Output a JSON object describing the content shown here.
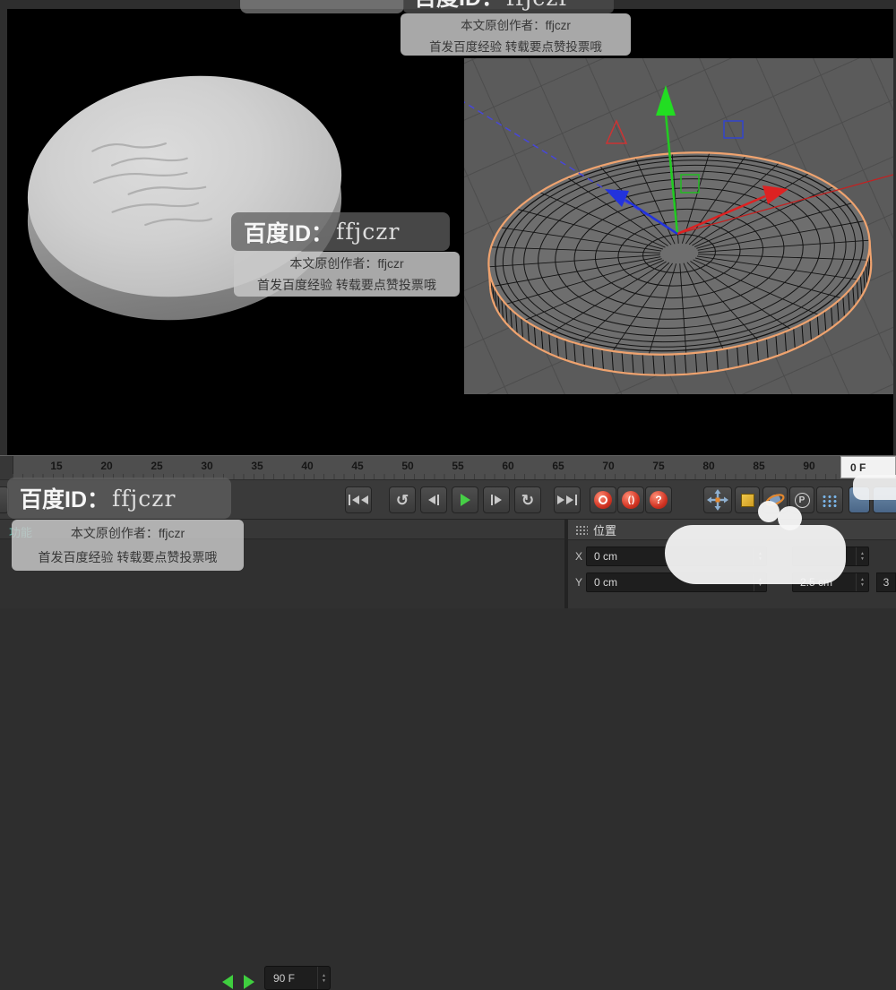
{
  "watermarks": {
    "badge_prefix": "百度ID：",
    "badge_user": "ffjczr",
    "author_line": "本文原创作者：ffjczr",
    "footer_line": "首发百度经验 转载要点赞投票哦"
  },
  "timeline": {
    "ticks": [
      "15",
      "20",
      "25",
      "30",
      "35",
      "40",
      "45",
      "50",
      "55",
      "60",
      "65",
      "70",
      "75",
      "80",
      "85",
      "90"
    ],
    "current_frame_label": "0 F"
  },
  "toolbar": {
    "frame_end_value": "90 F",
    "glyph_prev_key": "↺",
    "glyph_next_key": "↻",
    "glyph_autokey": "( )",
    "glyph_help": "?",
    "glyph_p": "P",
    "stepper_up": "▲",
    "stepper_down": "▼"
  },
  "coordinates_panel": {
    "title": "位置",
    "x_label": "X",
    "x_value": "0 cm",
    "y_label": "Y",
    "y_value": "0 cm",
    "col2_value": "2.5 cm",
    "edge_value": "3"
  },
  "left_tab_label": "功能"
}
